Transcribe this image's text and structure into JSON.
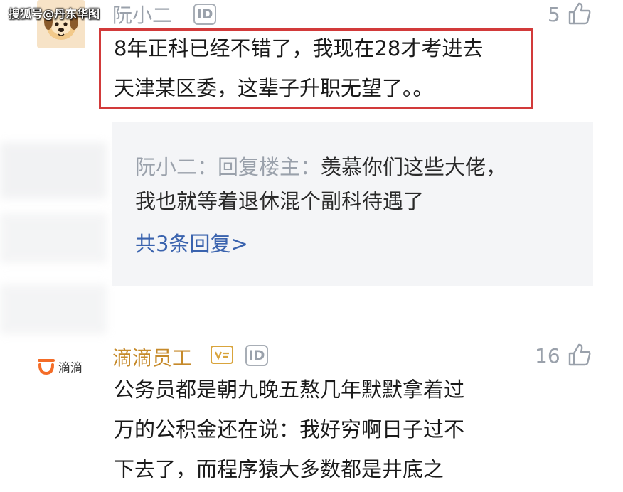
{
  "watermark": "搜狐号@丹东华图",
  "comment1": {
    "username": "阮小二",
    "id_badge": "ID",
    "likes": "5",
    "lines": [
      "8年正科已经不错了，我现在28才考进去",
      "天津某区委，这辈子升职无望了。。"
    ],
    "reply": {
      "author": "阮小二：回复楼主：",
      "text_line1": "羡慕你们这些大佬，",
      "text_line2": "我也就等着退休混个副科待遇了",
      "more_link": "共3条回复>"
    },
    "icons": {
      "avatar": "dog-avatar",
      "like": "thumbs-up-icon"
    }
  },
  "comment2": {
    "username": "滴滴员工",
    "badge": "vip-badge-icon",
    "id_badge": "ID",
    "likes": "16",
    "brand_logo_text": "滴滴",
    "lines": [
      "公务员都是朝九晚五熬几年默默拿着过",
      "万的公积金还在说：我好穷啊日子过不",
      "下去了，而程序猿大多数都是井底之"
    ]
  },
  "colors": {
    "highlight_border": "#d23a3a",
    "link_blue": "#3a63ae",
    "muted_gray": "#9aa1ab",
    "didi_orange": "#f46c27",
    "gold_name": "#c68a2a"
  }
}
